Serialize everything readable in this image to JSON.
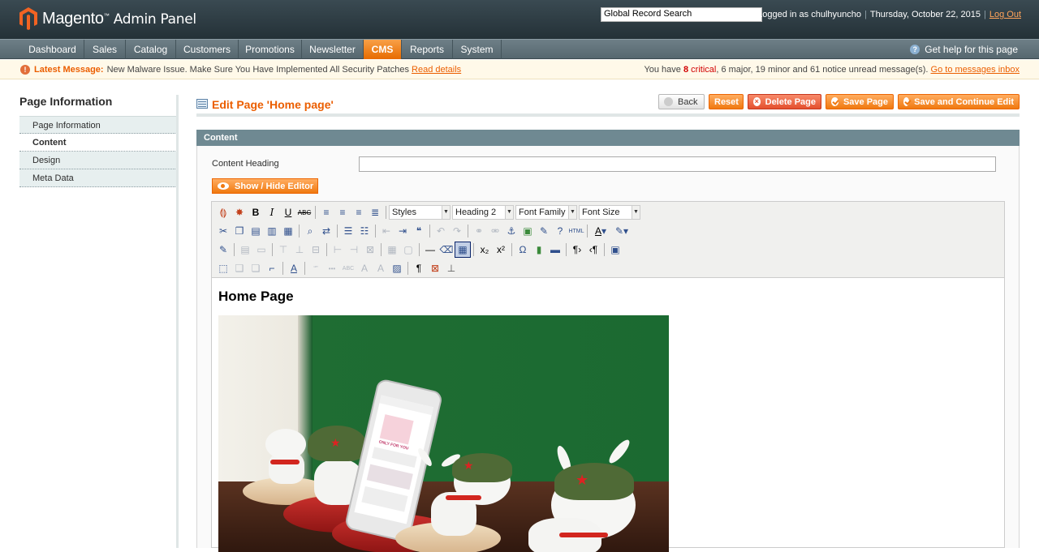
{
  "header": {
    "logo_brand": "Magento",
    "logo_sub": "Admin Panel",
    "search_value": "Global Record Search",
    "logged_in": "Logged in as chulhyuncho",
    "date": "Thursday, October 22, 2015",
    "logout": "Log Out",
    "separator": "|"
  },
  "nav": {
    "items": [
      "Dashboard",
      "Sales",
      "Catalog",
      "Customers",
      "Promotions",
      "Newsletter",
      "CMS",
      "Reports",
      "System"
    ],
    "active": "CMS",
    "help": "Get help for this page"
  },
  "message": {
    "label": "Latest Message:",
    "text": "New Malware Issue. Make Sure You Have Implemented All Security Patches",
    "link": "Read details",
    "summary_pre": "You have",
    "critical_count": "8",
    "critical_label": "critical",
    "major": "6 major,",
    "minor": "19 minor and",
    "notice": "61 notice unread message(s).",
    "inbox_link": "Go to messages inbox"
  },
  "sidebar": {
    "title": "Page Information",
    "tabs": [
      "Page Information",
      "Content",
      "Design",
      "Meta Data"
    ],
    "active": "Content"
  },
  "page": {
    "title": "Edit Page 'Home page'",
    "buttons": {
      "back": "Back",
      "reset": "Reset",
      "delete": "Delete Page",
      "save": "Save Page",
      "save_continue": "Save and Continue Edit"
    }
  },
  "content": {
    "section_title": "Content",
    "heading_label": "Content Heading",
    "heading_value": "",
    "toggle_editor": "Show / Hide Editor",
    "toolbar": {
      "styles": "Styles",
      "format": "Heading 2",
      "font_family": "Font Family",
      "font_size": "Font Size"
    },
    "doc_heading": "Home Page",
    "phone_screen_text": "ONLY FOR YOU"
  },
  "colors": {
    "accent": "#eb5e00",
    "header_bg": "#2b383e",
    "nav_bg": "#627278",
    "section_head": "#6f8992"
  }
}
